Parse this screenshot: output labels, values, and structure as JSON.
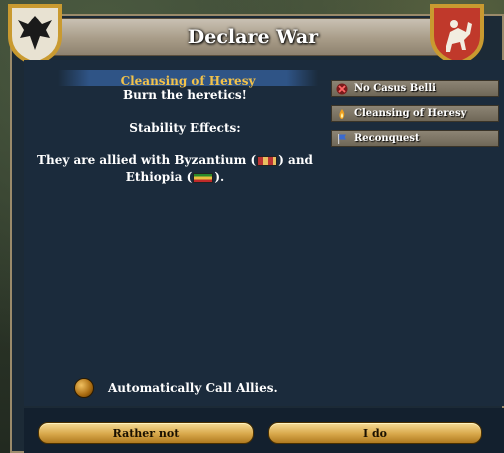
{
  "window": {
    "title": "Declare War"
  },
  "casus_belli": {
    "selected_name": "Cleansing of Heresy",
    "description": "Burn the heretics!",
    "stability_label": "Stability Effects:",
    "allies_line1_pre": "They are allied with Byzantium (",
    "allies_line1_post": ") and",
    "allies_line2_pre": "Ethiopia (",
    "allies_line2_post": ")."
  },
  "options": {
    "auto_call_allies": "Automatically Call Allies."
  },
  "cb_list": [
    {
      "label": "No Casus Belli",
      "icon": "cross-icon"
    },
    {
      "label": "Cleansing of Heresy",
      "icon": "flame-icon"
    },
    {
      "label": "Reconquest",
      "icon": "banner-icon"
    }
  ],
  "buttons": {
    "cancel": "Rather not",
    "confirm": "I do"
  },
  "colors": {
    "accent": "#f2c24a",
    "panel": "#1b2b3c",
    "button": "#d8a84a"
  }
}
